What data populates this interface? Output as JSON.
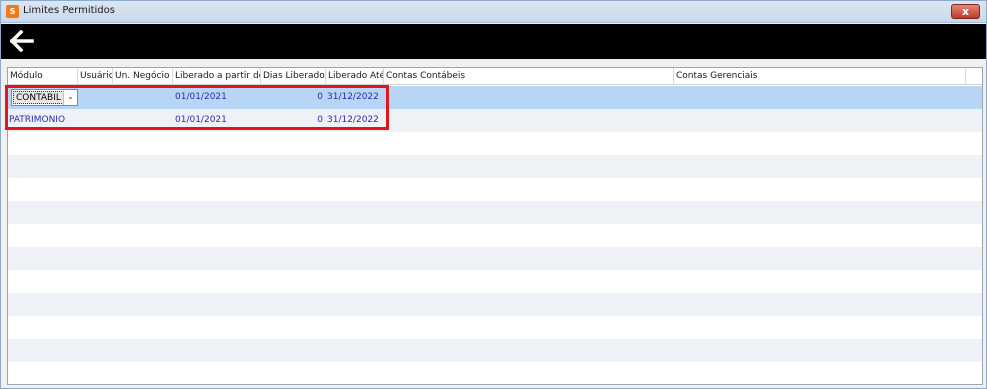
{
  "window": {
    "title": "Limites Permitidos",
    "icon": "app-logo-icon",
    "close_label": "x"
  },
  "toolbar": {
    "back_icon": "arrow-left-icon"
  },
  "grid": {
    "columns": [
      "Módulo",
      "Usuário",
      "Un. Negócio",
      "Liberado a partir de",
      "Dias Liberados",
      "Liberado Até",
      "Contas Contábeis",
      "Contas Gerenciais"
    ],
    "rows": [
      {
        "modulo": "CONTABIL",
        "usuario": "",
        "un_negocio": "",
        "liberado_de": "01/01/2021",
        "dias": "0",
        "liberado_ate": "31/12/2022",
        "contas_contabeis": "",
        "contas_gerenciais": ""
      },
      {
        "modulo": "PATRIMONIO",
        "usuario": "",
        "un_negocio": "",
        "liberado_de": "01/01/2021",
        "dias": "0",
        "liberado_ate": "31/12/2022",
        "contas_contabeis": "",
        "contas_gerenciais": ""
      }
    ]
  },
  "colors": {
    "selected_row": "#b7d6f5",
    "alt_row": "#eef2f7",
    "value_text": "#2a2ab0",
    "highlight_border": "#e3141c",
    "toolbar_bg": "#000000"
  }
}
